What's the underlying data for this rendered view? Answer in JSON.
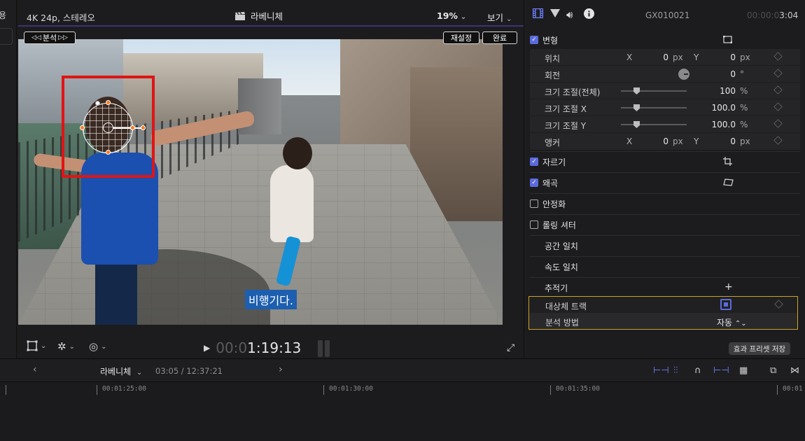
{
  "left_panel": {
    "partial_label": "용"
  },
  "viewer": {
    "format_label": "4K 24p, 스테레오",
    "clip_name": "라베니체",
    "zoom": "19%",
    "view_menu": "보기",
    "overlay": {
      "analyze_label": "분석",
      "reset_label": "재설정",
      "done_label": "완료",
      "caption": "비행기다."
    },
    "timecode": {
      "dim": "00:0",
      "bright": "1:19:13"
    }
  },
  "inspector": {
    "clip_name": "GX010021",
    "duration_dim": "00:00:0",
    "duration_bright": "3:04",
    "transform": {
      "label": "변형",
      "enabled": true,
      "params": [
        {
          "name": "위치",
          "x_label": "X",
          "x_value": "0",
          "x_unit": "px",
          "y_label": "Y",
          "y_value": "0",
          "y_unit": "px"
        },
        {
          "name": "회전",
          "value": "0",
          "unit": "°"
        },
        {
          "name": "크기 조절(전체)",
          "value": "100",
          "unit": "%"
        },
        {
          "name": "크기 조절 X",
          "value": "100.0",
          "unit": "%"
        },
        {
          "name": "크기 조절 Y",
          "value": "100.0",
          "unit": "%"
        },
        {
          "name": "앵커",
          "x_label": "X",
          "x_value": "0",
          "x_unit": "px",
          "y_label": "Y",
          "y_value": "0",
          "y_unit": "px"
        }
      ]
    },
    "crop": {
      "label": "자르기",
      "enabled": true
    },
    "distort": {
      "label": "왜곡",
      "enabled": true
    },
    "stabilization": {
      "label": "안정화",
      "enabled": false
    },
    "rolling_shutter": {
      "label": "롤링 셔터",
      "enabled": false
    },
    "spatial_conform": {
      "label": "공간 일치"
    },
    "rate_conform": {
      "label": "속도 일치"
    },
    "tracker": {
      "label": "추적기",
      "add_symbol": "+",
      "object_track_label": "대상체 트랙",
      "analysis_method_label": "분석 방법",
      "analysis_method_value": "자동"
    },
    "save_preset_label": "효과 프리셋 저장"
  },
  "timeline": {
    "project_name": "라베니체",
    "position": "03:05 / 12:37:21",
    "ruler_ticks": [
      "00:01:25:00",
      "00:01:30:00",
      "00:01:35:00",
      "00:01"
    ]
  },
  "colors": {
    "accent": "#5b6bdc",
    "tracker_box": "#e11414",
    "highlight_border": "#c9a227",
    "caption_bg": "#1d5faf"
  }
}
